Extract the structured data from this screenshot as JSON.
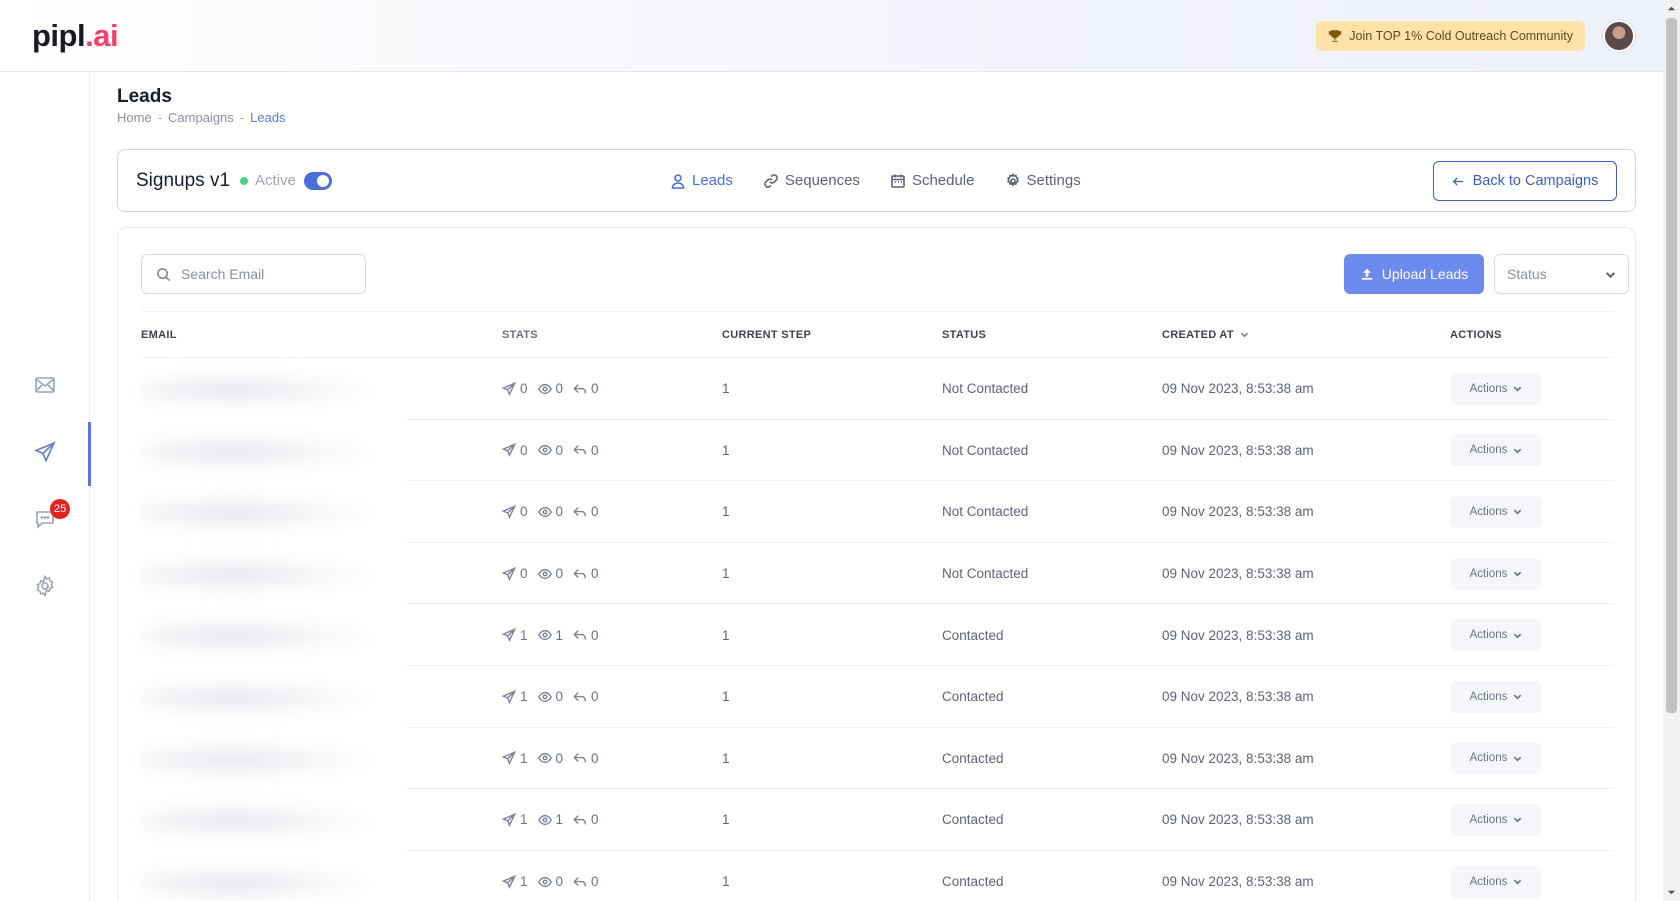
{
  "header": {
    "logo_main": "pipl",
    "logo_suffix": ".ai",
    "community_label": "Join TOP 1% Cold Outreach Community"
  },
  "sidebar": {
    "items": [
      {
        "name": "mail",
        "icon": "mail-icon"
      },
      {
        "name": "campaigns",
        "icon": "send-icon",
        "active": true
      },
      {
        "name": "inbox",
        "icon": "chat-icon",
        "badge": "25"
      },
      {
        "name": "settings",
        "icon": "gear-icon"
      }
    ]
  },
  "page": {
    "title": "Leads",
    "breadcrumb": {
      "home": "Home",
      "sep": "-",
      "campaigns": "Campaigns",
      "current": "Leads"
    }
  },
  "campaign": {
    "name": "Signups v1",
    "status": "Active",
    "tabs": {
      "leads": "Leads",
      "sequences": "Sequences",
      "schedule": "Schedule",
      "settings": "Settings"
    },
    "back_label": "Back to Campaigns"
  },
  "leads": {
    "search_placeholder": "Search Email",
    "upload_label": "Upload Leads",
    "status_select": "Status",
    "columns": {
      "email": "EMAIL",
      "stats": "STATS",
      "step": "CURRENT STEP",
      "status": "STATUS",
      "created": "CREATED AT",
      "actions": "ACTIONS"
    },
    "actions_label": "Actions",
    "rows": [
      {
        "sent": "0",
        "opened": "0",
        "replied": "0",
        "step": "1",
        "status": "Not Contacted",
        "created": "09 Nov 2023, 8:53:38 am"
      },
      {
        "sent": "0",
        "opened": "0",
        "replied": "0",
        "step": "1",
        "status": "Not Contacted",
        "created": "09 Nov 2023, 8:53:38 am"
      },
      {
        "sent": "0",
        "opened": "0",
        "replied": "0",
        "step": "1",
        "status": "Not Contacted",
        "created": "09 Nov 2023, 8:53:38 am"
      },
      {
        "sent": "0",
        "opened": "0",
        "replied": "0",
        "step": "1",
        "status": "Not Contacted",
        "created": "09 Nov 2023, 8:53:38 am"
      },
      {
        "sent": "1",
        "opened": "1",
        "replied": "0",
        "step": "1",
        "status": "Contacted",
        "created": "09 Nov 2023, 8:53:38 am"
      },
      {
        "sent": "1",
        "opened": "0",
        "replied": "0",
        "step": "1",
        "status": "Contacted",
        "created": "09 Nov 2023, 8:53:38 am"
      },
      {
        "sent": "1",
        "opened": "0",
        "replied": "0",
        "step": "1",
        "status": "Contacted",
        "created": "09 Nov 2023, 8:53:38 am"
      },
      {
        "sent": "1",
        "opened": "1",
        "replied": "0",
        "step": "1",
        "status": "Contacted",
        "created": "09 Nov 2023, 8:53:38 am"
      },
      {
        "sent": "1",
        "opened": "0",
        "replied": "0",
        "step": "1",
        "status": "Contacted",
        "created": "09 Nov 2023, 8:53:38 am"
      }
    ]
  },
  "colors": {
    "accent": "#4a6fd8",
    "upload_button": "#6d8bef",
    "badge": "#e02424",
    "active_dot": "#50cd89",
    "community_button": "#ffe2a8"
  }
}
